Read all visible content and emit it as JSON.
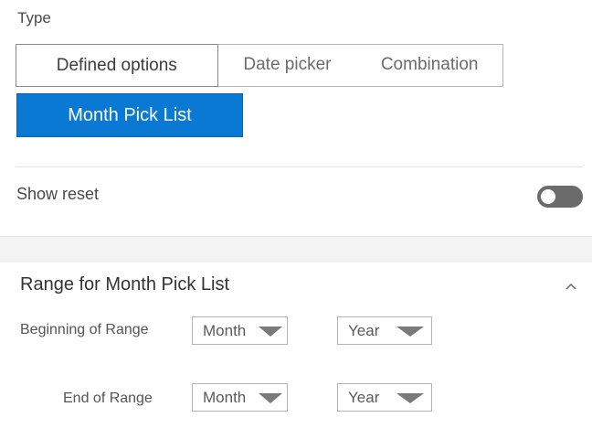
{
  "type_section": {
    "label": "Type",
    "tabs": [
      {
        "label": "Defined options",
        "active": true
      },
      {
        "label": "Date picker",
        "active": false
      },
      {
        "label": "Combination",
        "active": false
      }
    ],
    "selected_option": "Month Pick List"
  },
  "show_reset": {
    "label": "Show reset",
    "enabled": false
  },
  "range_section": {
    "title": "Range for Month Pick List",
    "beginning": {
      "label": "Beginning of Range",
      "month": "Month",
      "year": "Year"
    },
    "end": {
      "label": "End of Range",
      "month": "Month",
      "year": "Year"
    }
  },
  "icons": {
    "collapse": "chevron-up-icon",
    "dropdown": "caret-down-icon"
  },
  "colors": {
    "accent": "#0a79d3",
    "toggle_off": "#6b6b6b",
    "caret": "#7a7a7a"
  }
}
